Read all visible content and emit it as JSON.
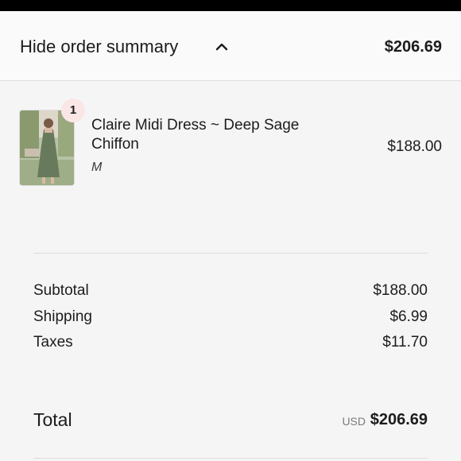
{
  "header": {
    "toggle_label": "Hide order summary",
    "chevron_icon": "chevron-up-icon",
    "total": "$206.69"
  },
  "cart": {
    "items": [
      {
        "quantity": "1",
        "name": "Claire Midi Dress ~ Deep Sage Chiffon",
        "variant": "M",
        "price": "$188.00",
        "thumbnail_icon": "product-photo"
      }
    ]
  },
  "summary": {
    "subtotal_label": "Subtotal",
    "subtotal_value": "$188.00",
    "shipping_label": "Shipping",
    "shipping_value": "$6.99",
    "taxes_label": "Taxes",
    "taxes_value": "$11.70"
  },
  "total": {
    "label": "Total",
    "currency": "USD",
    "amount": "$206.69"
  },
  "colors": {
    "badge_bg": "#fbe6e6",
    "page_bg": "#f5f5f5",
    "top_bar": "#000000"
  }
}
